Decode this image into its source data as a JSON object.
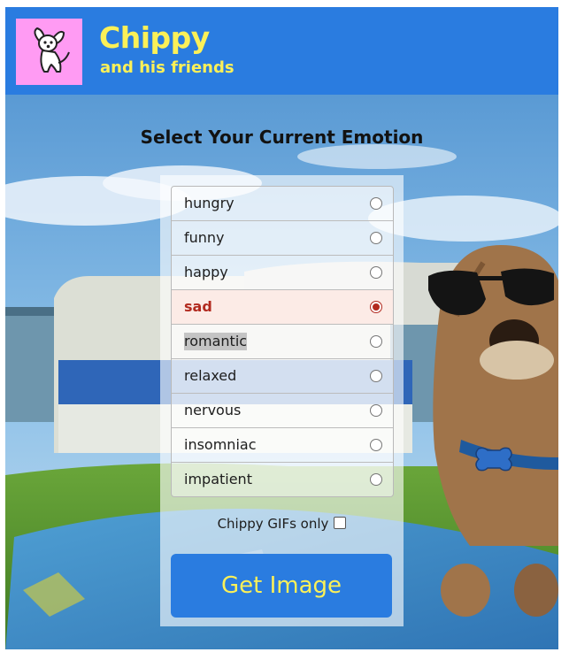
{
  "header": {
    "title": "Chippy",
    "subtitle": "and his friends",
    "logo_icon": "chippy-dog-logo-icon"
  },
  "main": {
    "heading": "Select Your Current Emotion",
    "options": [
      {
        "label": "hungry",
        "selected": false
      },
      {
        "label": "funny",
        "selected": false
      },
      {
        "label": "happy",
        "selected": false
      },
      {
        "label": "sad",
        "selected": true
      },
      {
        "label": "romantic",
        "selected": false
      },
      {
        "label": "relaxed",
        "selected": false
      },
      {
        "label": "nervous",
        "selected": false
      },
      {
        "label": "insomniac",
        "selected": false
      },
      {
        "label": "impatient",
        "selected": false
      }
    ],
    "gif_only_label": "Chippy GIFs only",
    "gif_only_checked": false,
    "get_button_label": "Get Image"
  },
  "colors": {
    "brand_blue": "#2a7ce0",
    "brand_yellow": "#fbf058",
    "logo_pink": "#ff9bf3",
    "selected_red": "#b22a1f"
  }
}
